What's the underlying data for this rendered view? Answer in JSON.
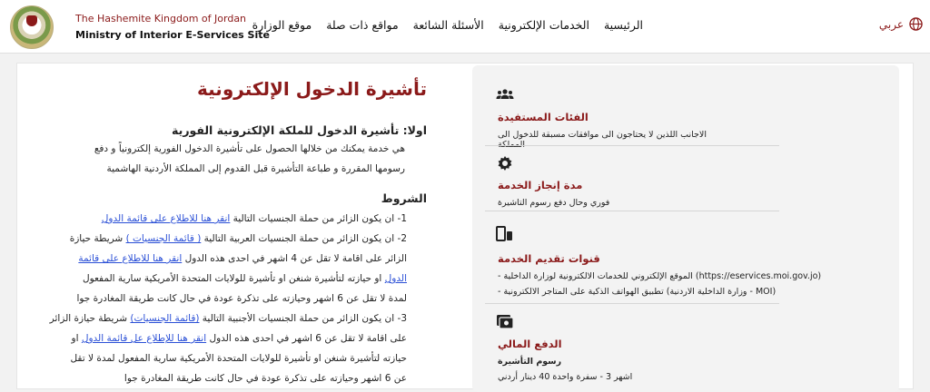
{
  "header": {
    "title_ar": "The Hashemite Kingdom of Jordan",
    "title_en": "Ministry of Interior E-Services Site",
    "nav": [
      "الرئيسية",
      "الخدمات الإلكترونية",
      "الأسئلة الشائعة",
      "مواقع ذات صلة",
      "موقع الوزارة"
    ],
    "lang": "عربي"
  },
  "content": {
    "title": "تأشيرة الدخول الإلكترونية",
    "sec1_title": "اولا: تأشيرة الدخول للملكة الإلكترونية الفورية",
    "sec1_line1": "هي خدمة يمكنك من خلالها الحصول على تأشيرة الدخول الفورية إلكترونياً و دفع",
    "sec1_line2": "رسومها المقررة و طباعة التأشيرة قبل القدوم إلى المملكة الأردنية الهاشمية",
    "conditions_title": "الشروط",
    "c1_text": "1- ان يكون الزائر من حملة الجنسيات التالية ",
    "c1_link": "انقر هنا للاطلاع على قائمة الدول",
    "c2_text": "2- ان يكون الزائر من حملة الجنسيات العربية التالية ",
    "c2_link": "( قائمة الجنسيات )",
    "c2_tail": " شريطة حيازة",
    "c3_text": "الزائر على اقامة لا تقل عن 4 اشهر في احدى هذه الدول ",
    "c3_link": "انقر هنا للاطلاع على قائمة",
    "c4_link": "الدول",
    "c4_text": " او حيازته لتأشيرة شنغن او تأشيرة للولايات المتحدة الأمريكية سارية المفعول",
    "c5_text": "لمدة لا تقل عن 6 اشهر وحيازته على تذكرة عودة في حال كانت طريقة المغادرة جوا",
    "c6_text": "3- ان يكون الزائر من حملة الجنسيات الأجنبية التالية ",
    "c6_link": "(قائمة الجنسيات)",
    "c6_tail": " شريطة حيازة الزائر",
    "c7_text": "على اقامة لا تقل عن 6 اشهر في احدى هذه الدول ",
    "c7_link": "انقر هنا للإطلاع عل قائمة الدول",
    "c7_tail": " او",
    "c8_text": "حيازته لتأشيرة شنغن او تأشيرة للولايات المتحدة الأمريكية سارية المفعول لمدة لا تقل",
    "c9_text": "عن 6 اشهر وحيازته على تذكرة عودة في حال كانت طريقة المغادرة جوا"
  },
  "info": {
    "beneficiaries_title": "الفئات المستفيدة",
    "beneficiaries_text": "الاجانب اللذين لا يحتاجون الى موافقات مسبقة للدخول الى المملكة",
    "duration_title": "مدة إنجاز الخدمة",
    "duration_text": "فوري وحال دفع رسوم التاشيرة",
    "channels_title": "قنوات تقديم الخدمة",
    "channel1": "- الموقع الإلكتروني للخدمات الالكترونية لوزارة الداخلية (https://eservices.moi.gov.jo)",
    "channel2": "- تطبيق الهواتف الذكية على المتاجر الالكترونية (وزارة الداخلية الاردنية - MOI)",
    "payment_title": "الدفع المالي",
    "fees_title": "رسوم التأشيرة",
    "fees_text": "اشهر 3 - سفرة واحدة 40 دينار أردني"
  }
}
